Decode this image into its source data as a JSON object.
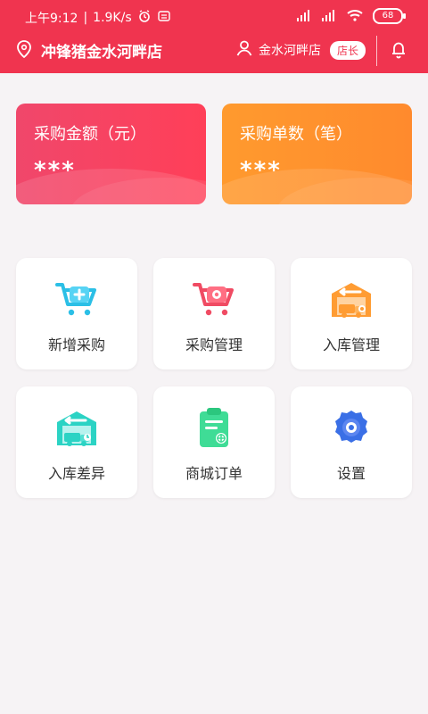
{
  "status_bar": {
    "time": "上午9:12",
    "net_speed": "1.9K/s",
    "battery": "68"
  },
  "header": {
    "store_title": "冲锋猪金水河畔店",
    "user_store": "金水河畔店",
    "role_badge": "店长"
  },
  "summary": [
    {
      "label": "采购金额（元）",
      "value": "***"
    },
    {
      "label": "采购单数（笔）",
      "value": "***"
    }
  ],
  "menu": [
    {
      "label": "新增采购",
      "icon": "cart-add-icon"
    },
    {
      "label": "采购管理",
      "icon": "cart-gear-icon"
    },
    {
      "label": "入库管理",
      "icon": "warehouse-truck-icon"
    },
    {
      "label": "入库差异",
      "icon": "warehouse-difference-icon"
    },
    {
      "label": "商城订单",
      "icon": "clipboard-order-icon"
    },
    {
      "label": "设置",
      "icon": "settings-gear-icon"
    }
  ],
  "colors": {
    "brand": "#f0344f",
    "orange": "#ff8a2d",
    "blue": "#3a6fe6",
    "teal": "#2bd3c4"
  }
}
